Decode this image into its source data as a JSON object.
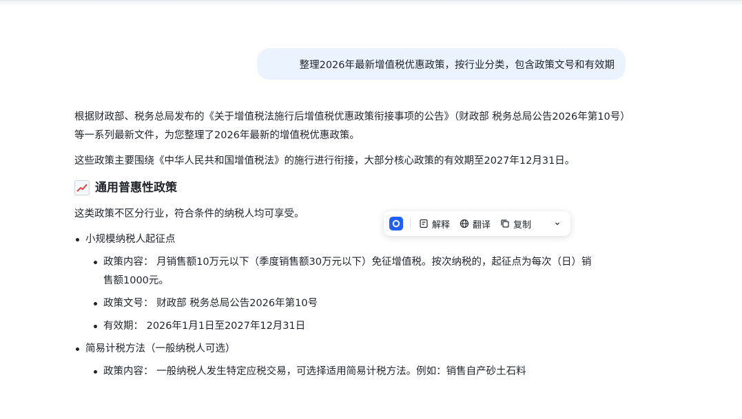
{
  "user_message": "整理2026年最新增值税优惠政策，按行业分类，包含政策文号和有效期",
  "answer": {
    "intro_paragraph": "根据财政部、税务总局发布的《关于增值税法施行后增值税优惠政策衔接事项的公告》（财政部 税务总局公告2026年第10号）等一系列最新文件，为您整理了2026年最新的增值税优惠政策。",
    "summary_paragraph": "这些政策主要围绕《中华人民共和国增值税法》的施行进行衔接，大部分核心政策的有效期至2027年12月31日。",
    "section": {
      "icon": "chart-increasing-icon",
      "title": "通用普惠性政策",
      "subtitle": "这类政策不区分行业，符合条件的纳税人均可享受。",
      "items": [
        {
          "label": "小规模纳税人起征点",
          "details": [
            "政策内容： 月销售额10万元以下（季度销售额30万元以下）免征增值税。按次纳税的，起征点为每次（日）销售额1000元。",
            "政策文号： 财政部 税务总局公告2026年第10号",
            "有效期： 2026年1月1日至2027年12月31日"
          ]
        },
        {
          "label": "简易计税方法（一般纳税人可选）",
          "details": [
            "政策内容： 一般纳税人发生特定应税交易，可选择适用简易计税方法。例如：销售自产砂土石料"
          ]
        }
      ]
    }
  },
  "selection_toolbar": {
    "logo_icon": "assistant-logo-icon",
    "explain_label": "解释",
    "translate_label": "翻译",
    "copy_label": "复制",
    "more_icon": "chevron-down-icon"
  }
}
